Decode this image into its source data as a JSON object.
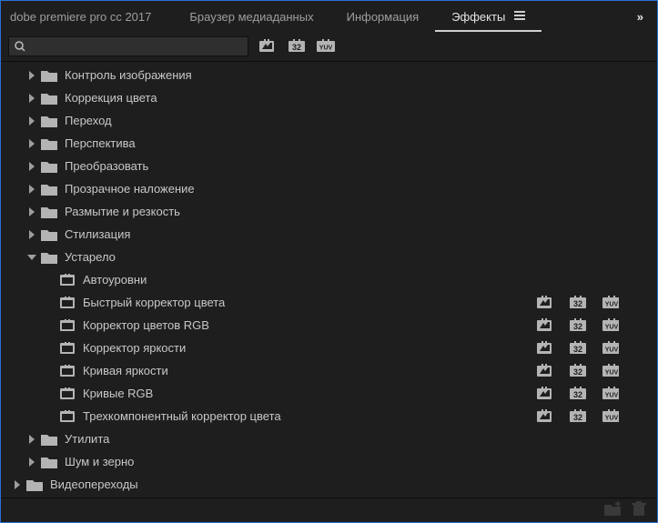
{
  "tabs": {
    "app": "dobe premiere pro cc 2017",
    "browser": "Браузер медиаданных",
    "info": "Информация",
    "effects": "Эффекты"
  },
  "overflow_glyph": "»",
  "search": {
    "placeholder": ""
  },
  "folders": {
    "image_control": "Контроль изображения",
    "color_correction": "Коррекция цвета",
    "transition": "Переход",
    "perspective": "Перспектива",
    "transform": "Преобразовать",
    "keying": "Прозрачное наложение",
    "blur_sharpen": "Размытие и резкость",
    "stylize": "Стилизация",
    "obsolete": "Устарело",
    "utility": "Утилита",
    "noise_grain": "Шум и зерно",
    "video_transitions": "Видеопереходы"
  },
  "obsolete_items": {
    "auto_levels": "Автоуровни",
    "fast_color": "Быстрый корректор цвета",
    "rgb_color": "Корректор цветов RGB",
    "luma_corrector": "Корректор яркости",
    "luma_curve": "Кривая яркости",
    "rgb_curves": "Кривые RGB",
    "three_way": "Трехкомпонентный корректор цвета"
  },
  "badges": {
    "b32_text": "32",
    "yuv_text": "YUV"
  }
}
